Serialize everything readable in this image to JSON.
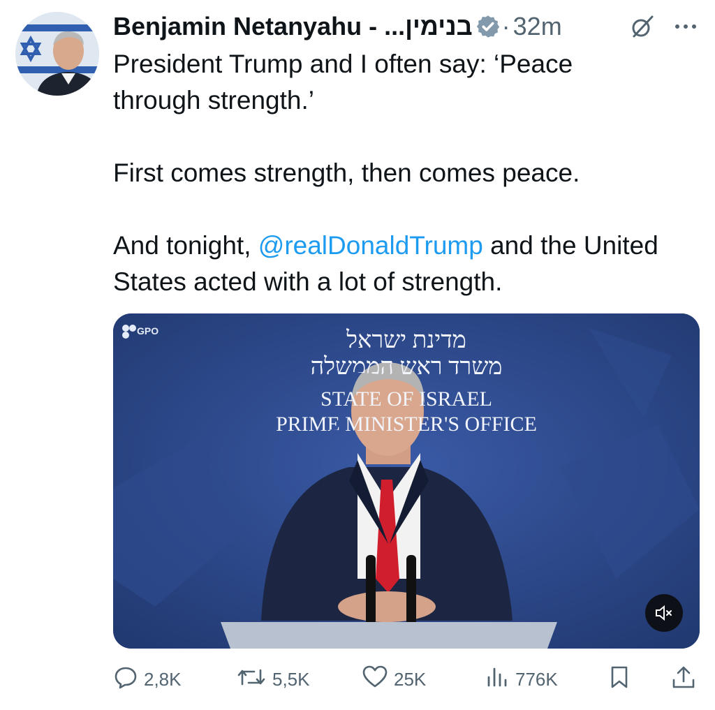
{
  "author": {
    "display_name": "Benjamin Netanyahu - ...בנימין",
    "verified": true,
    "separator": "·",
    "timestamp": "32m"
  },
  "tweet": {
    "line1": "President Trump and I often say: ‘Peace through strength.’",
    "line2": "First comes strength, then comes peace.",
    "line3_before": "And tonight, ",
    "line3_mention": "@realDonaldTrump",
    "line3_after": " and the United States acted with a lot of strength."
  },
  "media": {
    "watermark": "GPO",
    "banner_hebrew_1": "מדינת ישראל",
    "banner_hebrew_2": "משרד ראש הממשלה",
    "banner_english_1": "STATE OF ISRAEL",
    "banner_english_2": "PRIME MINISTER'S OFFICE",
    "muted": true
  },
  "actions": {
    "replies": "2,8K",
    "reposts": "5,5K",
    "likes": "25K",
    "views": "776K"
  },
  "colors": {
    "text": "#0f1419",
    "secondary": "#536471",
    "link": "#1d9bf0",
    "media_bg": "#2a4380"
  },
  "icons": [
    "verified-badge-icon",
    "grok-icon",
    "more-icon",
    "gpo-logo-icon",
    "mute-icon",
    "reply-icon",
    "repost-icon",
    "like-icon",
    "views-icon",
    "bookmark-icon",
    "share-icon"
  ]
}
